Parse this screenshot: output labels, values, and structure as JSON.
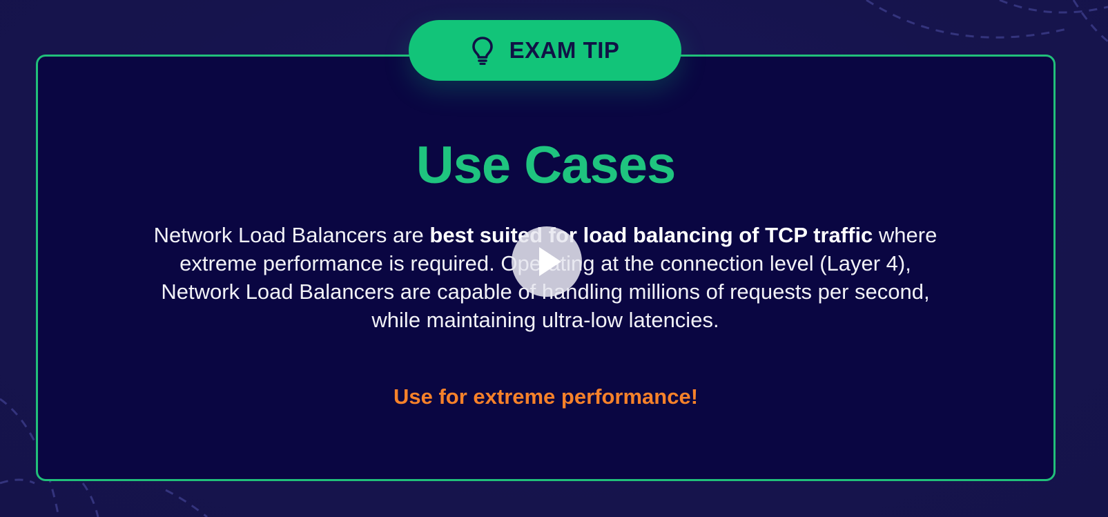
{
  "badge": {
    "icon": "lightbulb-icon",
    "label": "EXAM TIP"
  },
  "title": "Use Cases",
  "body": {
    "part1": "Network Load Balancers are ",
    "bold": "best suited for load balancing of TCP traffic",
    "part2": " where extreme performance is required. Operating at the connection level (Layer 4), Network Load Balancers are capable of handling millions of requests per second, while maintaining ultra-low latencies."
  },
  "highlight": "Use for extreme performance!",
  "player": {
    "icon": "play-icon"
  },
  "colors": {
    "background": "#17154f",
    "card": "#0a0642",
    "accent_green": "#21c07a",
    "accent_orange": "#f6812a",
    "text": "#f2f2f7"
  }
}
